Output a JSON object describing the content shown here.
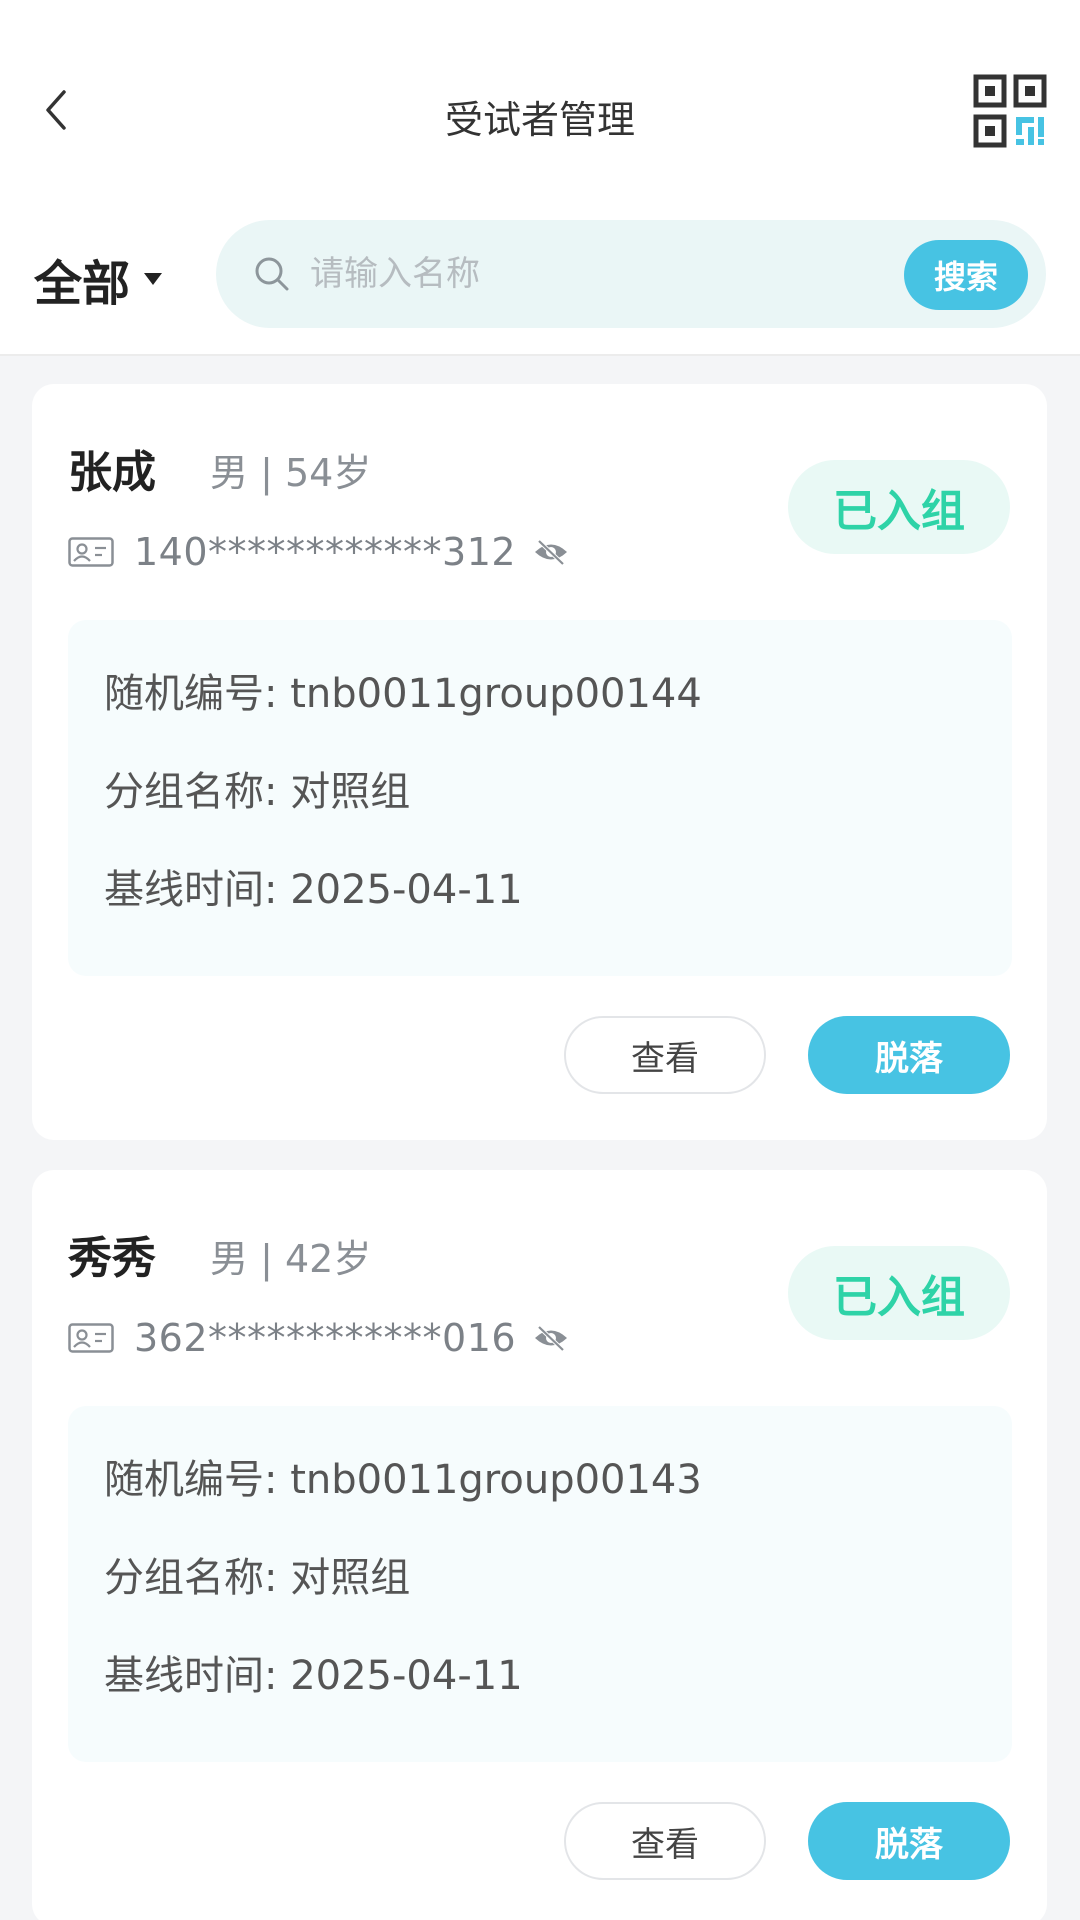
{
  "header": {
    "title": "受试者管理"
  },
  "filter": {
    "label": "全部"
  },
  "search": {
    "placeholder": "请输入名称",
    "value": "",
    "button_label": "搜索"
  },
  "subjects": [
    {
      "name": "张成",
      "meta": "男 | 54岁",
      "id_masked": "140************312",
      "status": "已入组",
      "random_no": "随机编号: tnb0011group00144",
      "group_name": "分组名称: 对照组",
      "baseline": "基线时间: 2025-04-11",
      "view_label": "查看",
      "drop_label": "脱落"
    },
    {
      "name": "秀秀",
      "meta": "男 | 42岁",
      "id_masked": "362************016",
      "status": "已入组",
      "random_no": "随机编号: tnb0011group00143",
      "group_name": "分组名称: 对照组",
      "baseline": "基线时间: 2025-04-11",
      "view_label": "查看",
      "drop_label": "脱落"
    }
  ],
  "colors": {
    "accent": "#47c3e3",
    "status_text": "#2ed3a7",
    "status_bg": "#e9f9f5",
    "search_bg": "#eaf6f6"
  },
  "icons": [
    "back-chevron-icon",
    "qr-code-icon",
    "search-icon",
    "id-card-icon",
    "eye-off-icon"
  ]
}
